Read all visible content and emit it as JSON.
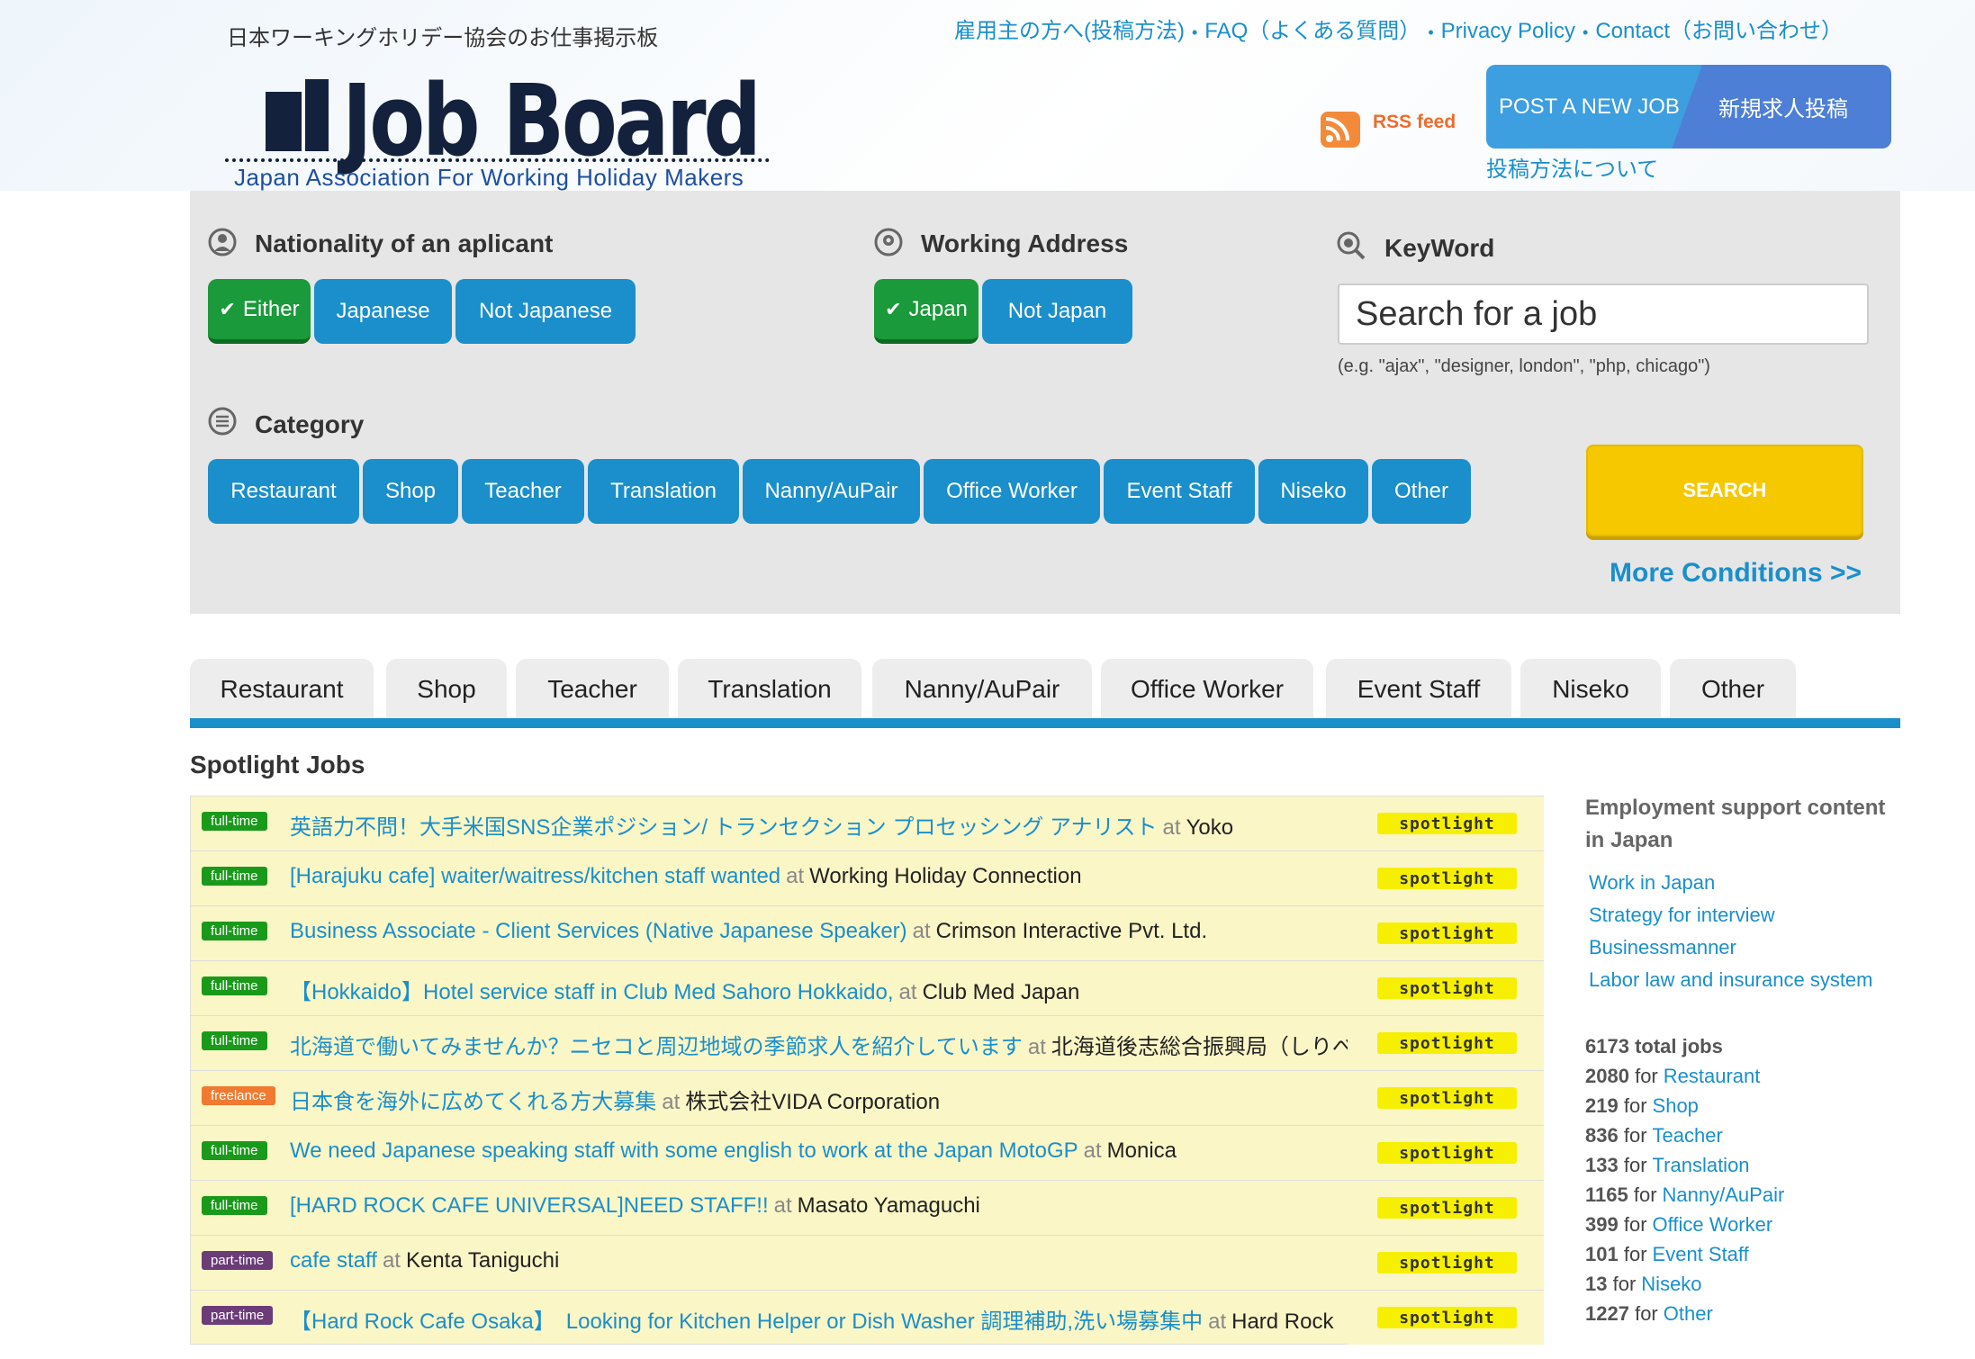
{
  "header": {
    "tagline": "日本ワーキングホリデー協会のお仕事掲示板",
    "top_links": [
      "雇用主の方へ(投稿方法)",
      "FAQ（よくある質問）",
      "Privacy Policy",
      "Contact（お問い合わせ）"
    ],
    "logo_title": "Job Board",
    "logo_subtitle": "Japan Association For Working Holiday Makers",
    "rss_label": "RSS feed",
    "post_job_en": "POST A NEW JOB",
    "post_job_jp": "新規求人投稿",
    "howto_link": "投稿方法について"
  },
  "filters": {
    "nationality": {
      "title": "Nationality of an aplicant",
      "options": [
        "Either",
        "Japanese",
        "Not Japanese"
      ],
      "selected": "Either"
    },
    "address": {
      "title": "Working Address",
      "options": [
        "Japan",
        "Not Japan"
      ],
      "selected": "Japan"
    },
    "keyword": {
      "title": "KeyWord",
      "placeholder": "Search for a job",
      "hint": "(e.g. \"ajax\", \"designer, london\", \"php, chicago\")"
    },
    "category": {
      "title": "Category",
      "options": [
        "Restaurant",
        "Shop",
        "Teacher",
        "Translation",
        "Nanny/AuPair",
        "Office Worker",
        "Event Staff",
        "Niseko",
        "Other"
      ]
    },
    "search_label": "SEARCH",
    "more_conditions": "More Conditions >>"
  },
  "tabs": [
    "Restaurant",
    "Shop",
    "Teacher",
    "Translation",
    "Nanny/AuPair",
    "Office Worker",
    "Event Staff",
    "Niseko",
    "Other"
  ],
  "spotlight": {
    "title": "Spotlight Jobs",
    "at_word": "at",
    "badge_label": "spotlight",
    "jobs": [
      {
        "type": "full-time",
        "title": "英語力不問！大手米国SNS企業ポジション/ トランセクション プロセッシング アナリスト",
        "company": "Yoko"
      },
      {
        "type": "full-time",
        "title": "[Harajuku cafe] waiter/waitress/kitchen staff wanted",
        "company": "Working Holiday Connection"
      },
      {
        "type": "full-time",
        "title": "Business Associate - Client Services (Native Japanese Speaker)",
        "company": "Crimson Interactive Pvt. Ltd."
      },
      {
        "type": "full-time",
        "title": "【Hokkaido】Hotel service staff in Club Med Sahoro Hokkaido,",
        "company": "Club Med Japan"
      },
      {
        "type": "full-time",
        "title": "北海道で働いてみませんか？ニセコと周辺地域の季節求人を紹介しています",
        "company": "北海道後志総合振興局（しりべし"
      },
      {
        "type": "freelance",
        "title": "日本食を海外に広めてくれる方大募集",
        "company": "株式会社VIDA Corporation"
      },
      {
        "type": "full-time",
        "title": "We need Japanese speaking staff with some english to work at the Japan MotoGP",
        "company": "Monica"
      },
      {
        "type": "full-time",
        "title": "[HARD ROCK CAFE UNIVERSAL]NEED STAFF!!",
        "company": "Masato Yamaguchi"
      },
      {
        "type": "part-time",
        "title": "cafe staff",
        "company": "Kenta Taniguchi"
      },
      {
        "type": "part-time",
        "title": "【Hard Rock Cafe Osaka】　Looking for Kitchen Helper or Dish Washer 調理補助,洗い場募集中",
        "company": "Hard Rock"
      }
    ]
  },
  "sidebar": {
    "title": "Employment support content in Japan",
    "links": [
      "Work in Japan",
      "Strategy for interview",
      "Businessmanner",
      "Labor law and insurance system"
    ],
    "total": "6173",
    "total_label": "total jobs",
    "for_word": "for",
    "counts": [
      {
        "n": "2080",
        "cat": "Restaurant"
      },
      {
        "n": "219",
        "cat": "Shop"
      },
      {
        "n": "836",
        "cat": "Teacher"
      },
      {
        "n": "133",
        "cat": "Translation"
      },
      {
        "n": "1165",
        "cat": "Nanny/AuPair"
      },
      {
        "n": "399",
        "cat": "Office Worker"
      },
      {
        "n": "101",
        "cat": "Event Staff"
      },
      {
        "n": "13",
        "cat": "Niseko"
      },
      {
        "n": "1227",
        "cat": "Other"
      }
    ]
  },
  "colors": {
    "accent": "#1a8fcc",
    "selected": "#1a9a3a",
    "search": "#f5c800",
    "spotlight_row": "#fbf6c6"
  }
}
